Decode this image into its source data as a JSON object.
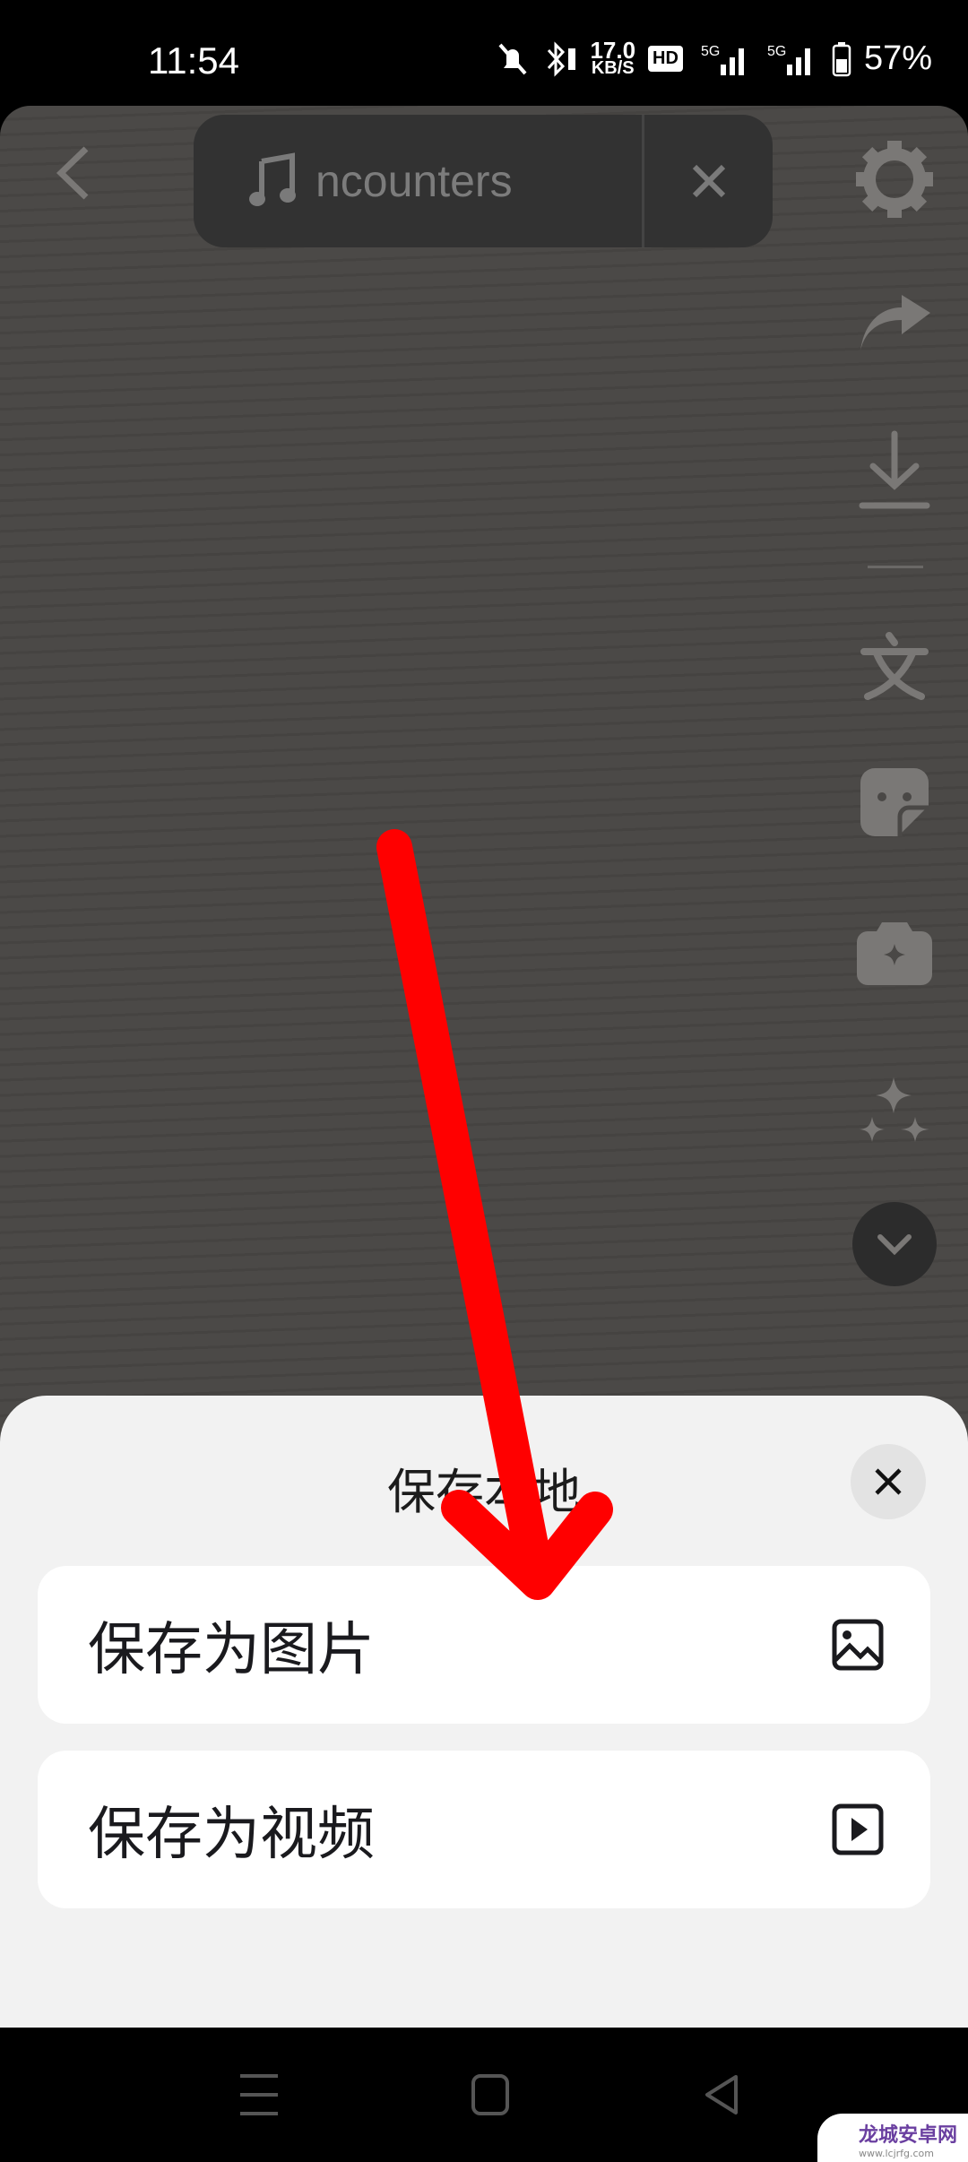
{
  "status_bar": {
    "time": "11:54",
    "net_speed_value": "17.0",
    "net_speed_unit": "KB/S",
    "hd_badge": "HD",
    "battery": "57%"
  },
  "top_bar": {
    "music_title": "ncounters"
  },
  "sheet": {
    "title": "保存本地",
    "options": [
      {
        "label": "保存为图片",
        "icon": "image-icon"
      },
      {
        "label": "保存为视频",
        "icon": "play-video-icon"
      }
    ]
  },
  "watermark": {
    "name": "龙城安卓网",
    "url": "www.lcjrfg.com"
  },
  "colors": {
    "annotation_arrow": "#ff0000",
    "sheet_bg": "#f2f2f2"
  }
}
